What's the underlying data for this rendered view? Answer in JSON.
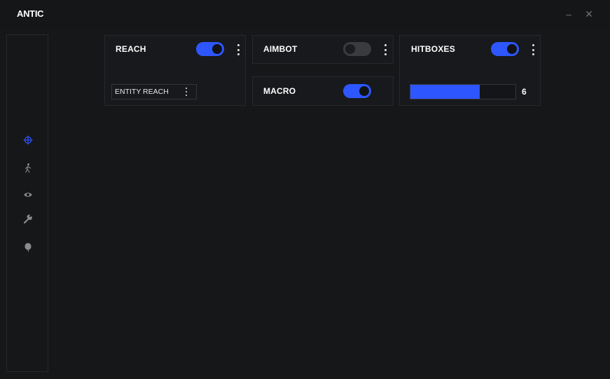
{
  "app": {
    "title": "ANTIC"
  },
  "window_controls": {
    "minimize": "–",
    "close": "✕"
  },
  "sidebar": {
    "items": [
      {
        "name": "combat",
        "icon": "crosshair-icon",
        "active": true
      },
      {
        "name": "movement",
        "icon": "walking-person-icon",
        "active": false
      },
      {
        "name": "render",
        "icon": "eye-icon",
        "active": false
      },
      {
        "name": "utility",
        "icon": "wrench-icon",
        "active": false
      },
      {
        "name": "misc",
        "icon": "balloon-icon",
        "active": false
      }
    ]
  },
  "modules": {
    "reach": {
      "title": "REACH",
      "enabled": true,
      "setting_label": "ENTITY REACH"
    },
    "aimbot": {
      "title": "AIMBOT",
      "enabled": false
    },
    "macro": {
      "title": "MACRO",
      "enabled": true
    },
    "hitboxes": {
      "title": "HITBOXES",
      "enabled": true,
      "slider_value": "6",
      "slider_fraction": 0.66
    }
  },
  "colors": {
    "accent": "#2d56ff",
    "background": "#161719",
    "border": "#26282c"
  }
}
